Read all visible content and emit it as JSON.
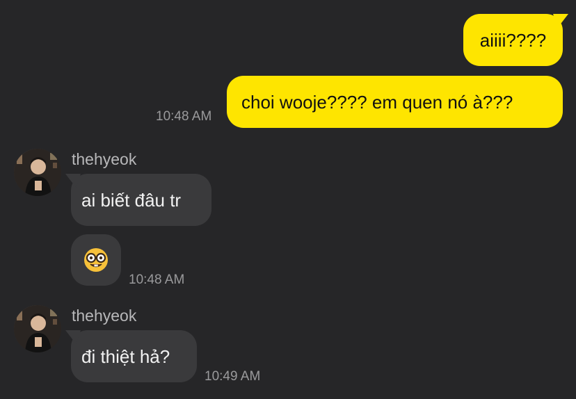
{
  "messages": {
    "out1": {
      "text": "aiiii????"
    },
    "out2": {
      "text": "choi wooje???? em quen nó à???",
      "time": "10:48 AM"
    },
    "group1": {
      "sender": "thehyeok",
      "msg1": "ai biết đâu tr",
      "emoji": "nerd-face-emoji",
      "time": "10:48 AM"
    },
    "group2": {
      "sender": "thehyeok",
      "msg1": "đi thiệt hả?",
      "time": "10:49 AM"
    }
  },
  "colors": {
    "background": "#262628",
    "outgoing_bubble": "#fee500",
    "incoming_bubble": "#3a3a3c"
  }
}
